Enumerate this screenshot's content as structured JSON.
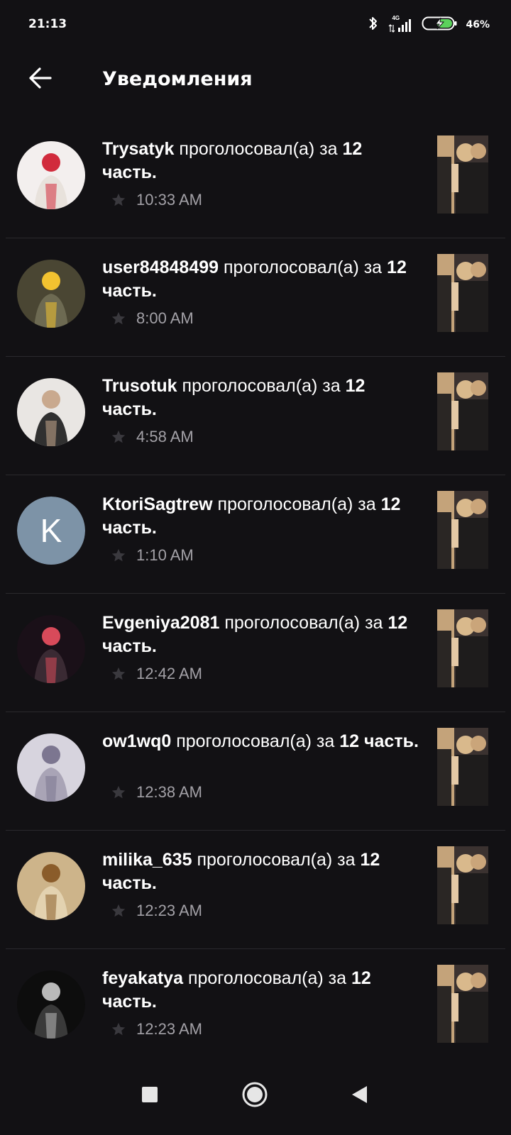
{
  "status_bar": {
    "time": "21:13",
    "network": "4G",
    "battery": "46%"
  },
  "header": {
    "title": "Уведомления"
  },
  "notifications": [
    {
      "username": "Trysatyk",
      "action": "проголосовал(а) за",
      "part_number": "12",
      "part_word": "часть.",
      "time": "10:33 AM",
      "avatar_type": "photo"
    },
    {
      "username": "user84848499",
      "action": "проголосовал(а) за",
      "part_number": "12",
      "part_word": "часть.",
      "time": "8:00 AM",
      "avatar_type": "photo"
    },
    {
      "username": "Trusotuk",
      "action": "проголосовал(а) за",
      "part_number": "12",
      "part_word": "часть.",
      "time": "4:58 AM",
      "avatar_type": "photo"
    },
    {
      "username": "KtoriSagtrew",
      "action": "проголосовал(а) за",
      "part_number": "12",
      "part_word": "часть.",
      "time": "1:10 AM",
      "avatar_type": "letter",
      "avatar_letter": "K",
      "avatar_color": "#7d93a7"
    },
    {
      "username": "Evgeniya2081",
      "action": "проголосовал(а) за",
      "part_number": "12",
      "part_word": "часть.",
      "time": "12:42 AM",
      "avatar_type": "photo"
    },
    {
      "username": "ow1wq0",
      "action": "проголосовал(а) за",
      "part_number": "12",
      "part_word": "часть.",
      "time": "12:38 AM",
      "avatar_type": "photo"
    },
    {
      "username": "milika_635",
      "action": "проголосовал(а) за",
      "part_number": "12",
      "part_word": "часть.",
      "time": "12:23 AM",
      "avatar_type": "photo"
    },
    {
      "username": "feyakatya",
      "action": "проголосовал(а) за",
      "part_number": "12",
      "part_word": "часть.",
      "time": "12:23 AM",
      "avatar_type": "photo"
    }
  ],
  "colors": {
    "background": "#121114",
    "divider": "#2a292d",
    "secondary_text": "#a3a1a7"
  },
  "icons": {
    "back": "arrow-left-icon",
    "star": "star-icon",
    "nav_recent": "square-icon",
    "nav_home": "circle-icon",
    "nav_back": "triangle-left-icon"
  }
}
